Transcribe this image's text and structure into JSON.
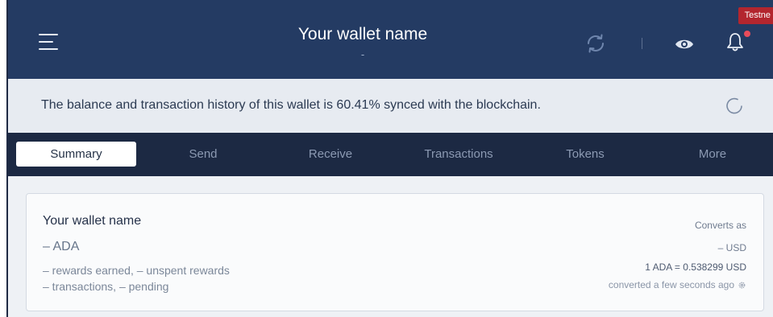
{
  "header": {
    "wallet_title": "Your wallet name",
    "title_sub": "-",
    "badge": "Testne",
    "icons": [
      "menu-icon",
      "sync-icon",
      "eye-icon",
      "bell-icon"
    ],
    "colors": {
      "header_bg": "#243b63",
      "badge_bg": "#b3262e",
      "notification_dot": "#ea4c5b"
    }
  },
  "sync_banner": {
    "text": "The balance and transaction history of this wallet is 60.41% synced with the blockchain.",
    "progress_percent": 60.41
  },
  "tabs": [
    {
      "label": "Summary",
      "active": true
    },
    {
      "label": "Send",
      "active": false
    },
    {
      "label": "Receive",
      "active": false
    },
    {
      "label": "Transactions",
      "active": false
    },
    {
      "label": "Tokens",
      "active": false
    },
    {
      "label": "More",
      "active": false
    }
  ],
  "summary": {
    "wallet_name": "Your wallet name",
    "ada_amount": "– ADA",
    "rewards_line": "– rewards earned, – unspent rewards",
    "transactions_line": "– transactions, – pending",
    "converts_label": "Converts as",
    "usd_amount": "– USD",
    "rate": "1 ADA = 0.538299 USD",
    "converted_time": "converted a few seconds ago"
  }
}
